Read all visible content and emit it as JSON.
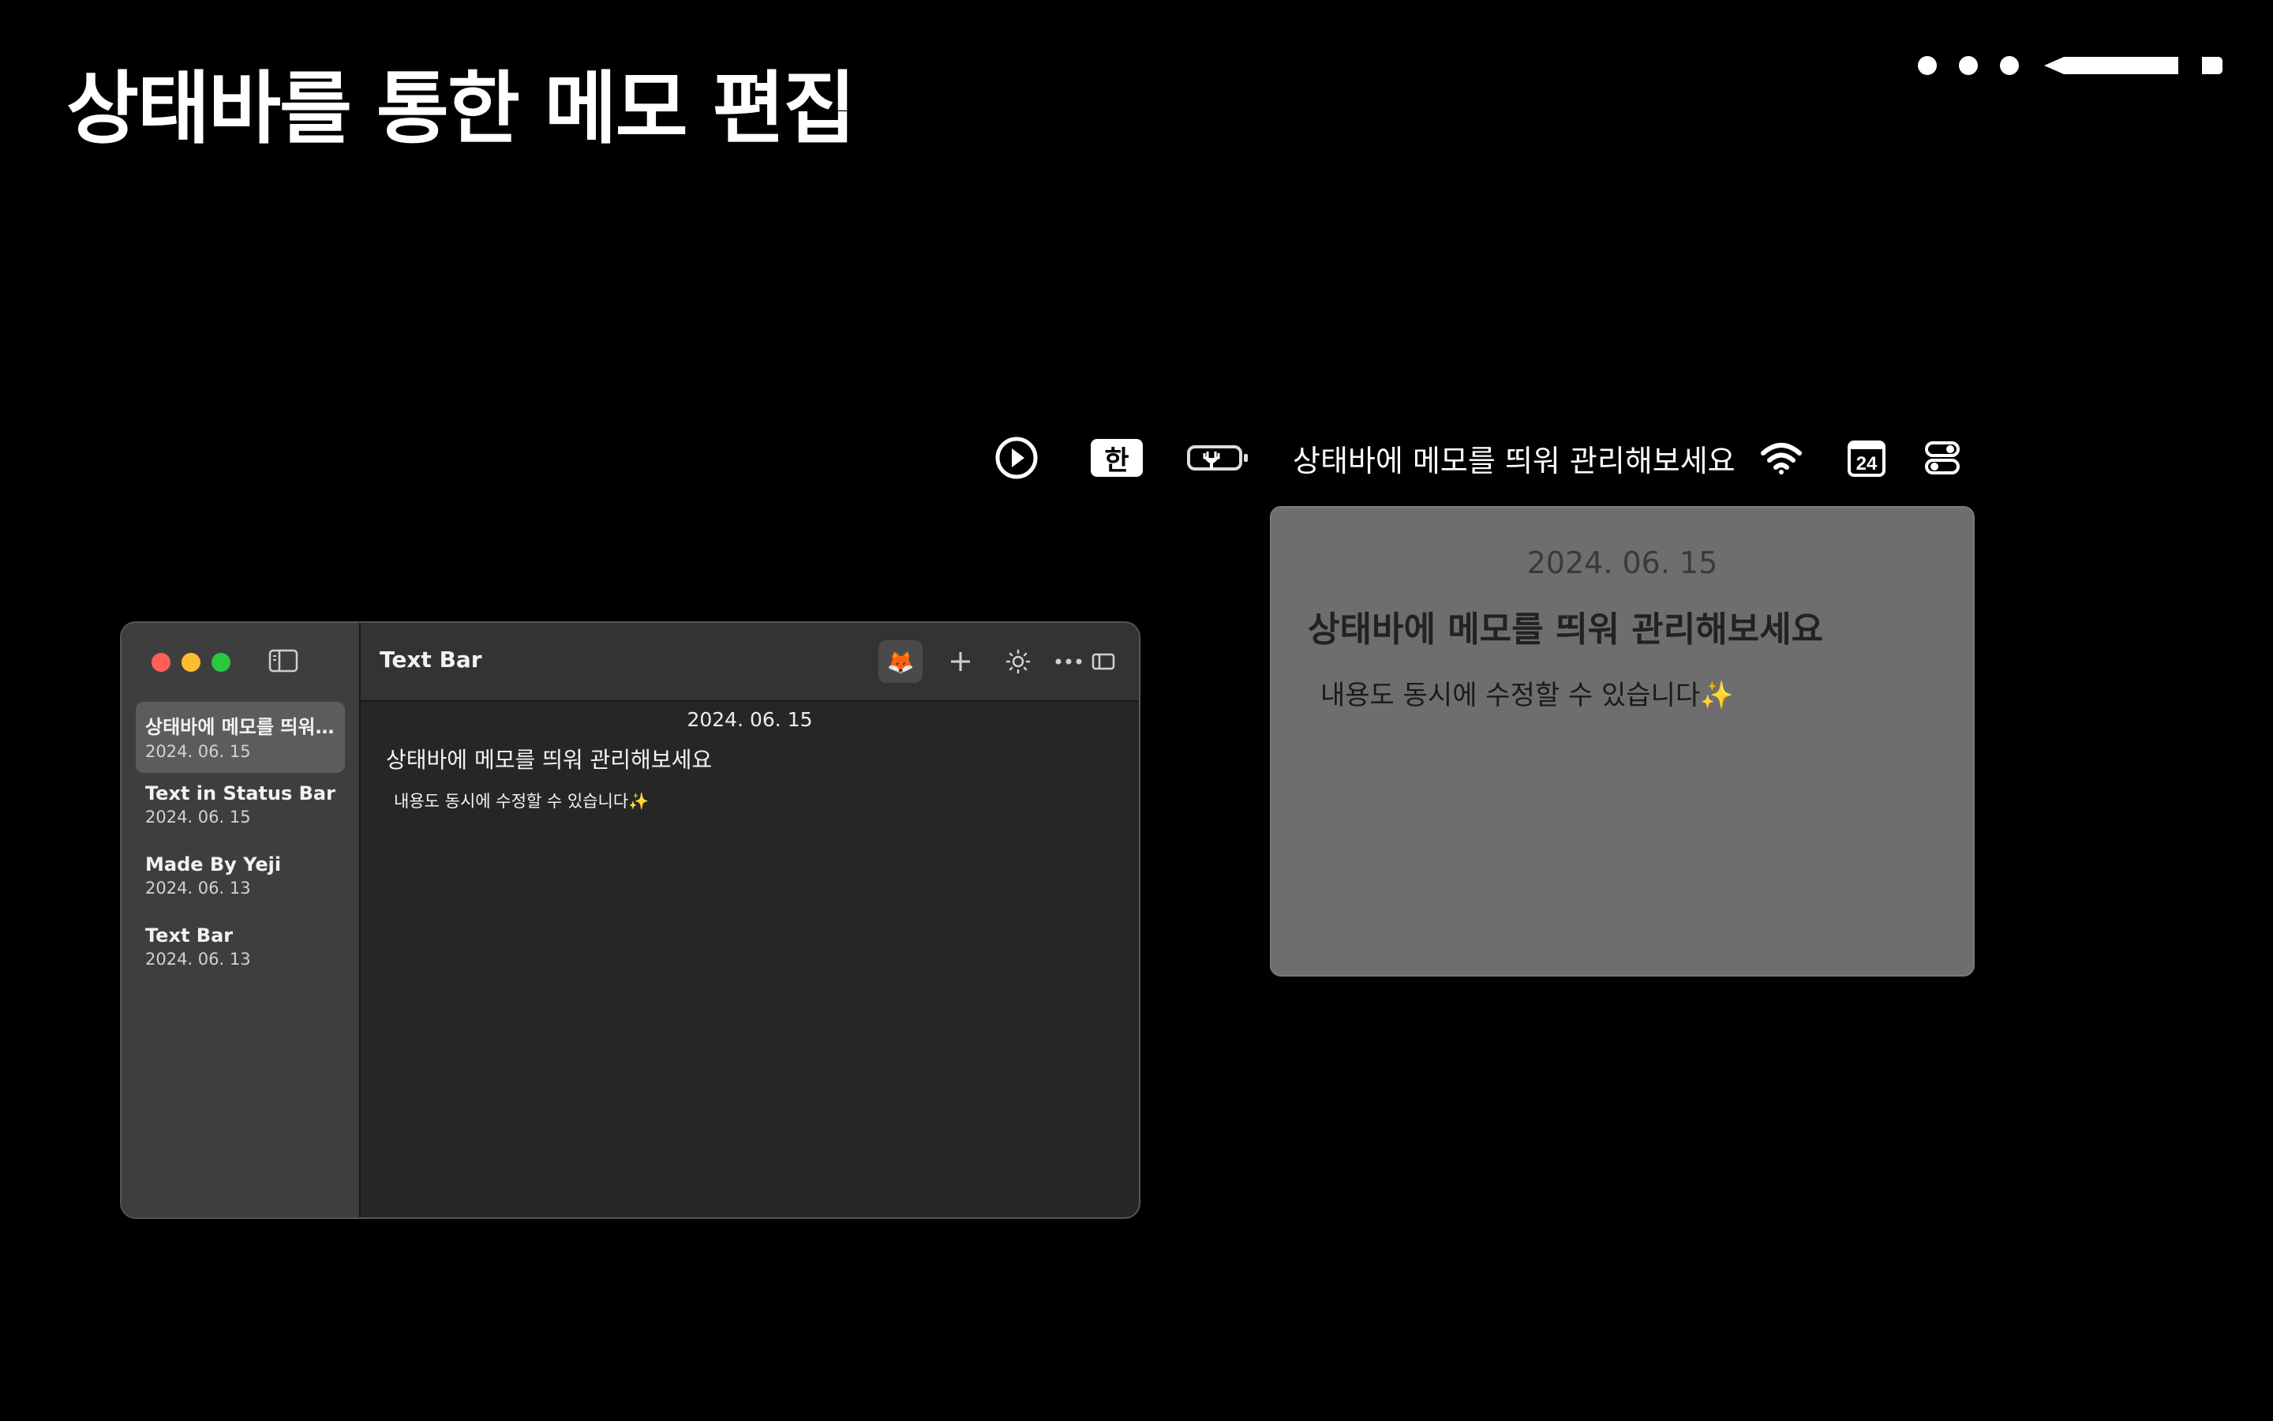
{
  "page": {
    "headline": "상태바를 통한 메모 편집"
  },
  "menubar": {
    "ime_label": "한",
    "status_text": "상태바에 메모를 띄워 관리해보세요",
    "calendar_day": "24",
    "icons": [
      "play-circle-icon",
      "ime-indicator",
      "battery-charging-icon",
      "wifi-icon",
      "calendar-icon",
      "control-center-icon"
    ]
  },
  "popover": {
    "date": "2024. 06. 15",
    "title": "상태바에 메모를 띄워 관리해보세요",
    "body": "내용도 동시에 수정할 수 있습니다✨"
  },
  "window": {
    "app_title": "Text Bar",
    "toolbar_icons": [
      "fox-emoji-button",
      "plus-icon",
      "sun-icon",
      "ellipsis-icon",
      "sidebar-right-icon"
    ],
    "fox_glyph": "🦊",
    "notes": [
      {
        "title": "상태바에 메모를 띄워...",
        "date": "2024. 06. 15",
        "selected": true
      },
      {
        "title": "Text in Status Bar",
        "date": "2024. 06. 15",
        "selected": false
      },
      {
        "title": "Made By Yeji",
        "date": "2024. 06. 13",
        "selected": false
      },
      {
        "title": "Text Bar",
        "date": "2024. 06. 13",
        "selected": false
      }
    ],
    "editor": {
      "date": "2024. 06. 15",
      "title": "상태바에 메모를 띄워 관리해보세요",
      "body": "내용도 동시에 수정할 수 있습니다✨"
    }
  },
  "colors": {
    "background": "#000000",
    "popover_bg": "#6e6e6e",
    "sidebar_bg": "#3e3e3e",
    "editor_bg": "#262626",
    "close": "#ff5f57",
    "minimize": "#febc2e",
    "zoom": "#28c840"
  }
}
